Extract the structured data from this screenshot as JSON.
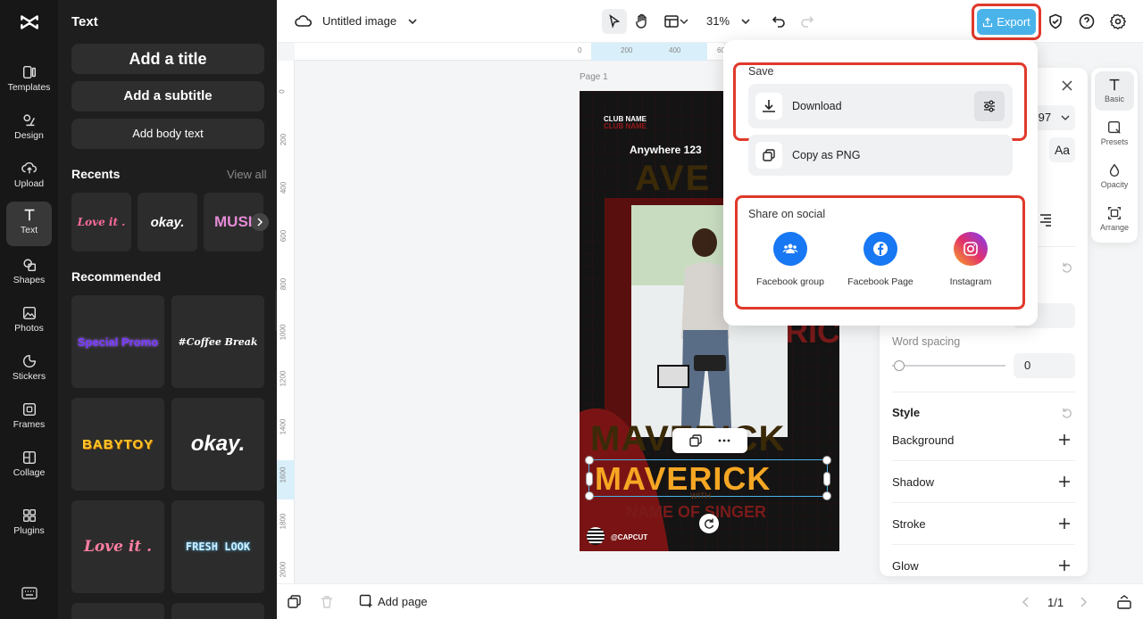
{
  "rail": {
    "items": [
      {
        "label": "Templates",
        "icon": "templates-icon"
      },
      {
        "label": "Design",
        "icon": "design-icon"
      },
      {
        "label": "Upload",
        "icon": "upload-icon"
      },
      {
        "label": "Text",
        "icon": "text-icon"
      },
      {
        "label": "Shapes",
        "icon": "shapes-icon"
      },
      {
        "label": "Photos",
        "icon": "photos-icon"
      },
      {
        "label": "Stickers",
        "icon": "stickers-icon"
      },
      {
        "label": "Frames",
        "icon": "frames-icon"
      },
      {
        "label": "Collage",
        "icon": "collage-icon"
      },
      {
        "label": "Plugins",
        "icon": "plugins-icon"
      }
    ]
  },
  "panel": {
    "heading": "Text",
    "add_title": "Add a title",
    "add_subtitle": "Add a subtitle",
    "add_body": "Add body text",
    "recents_label": "Recents",
    "view_all": "View all",
    "recents": [
      "Love it .",
      "okay.",
      "MUSIC"
    ],
    "recommended_label": "Recommended",
    "recommended": [
      "Special Promo",
      "#Coffee Break",
      "BABYTOY",
      "okay.",
      "Love it .",
      "FRESH LOOK"
    ]
  },
  "topbar": {
    "doc_title": "Untitled image",
    "zoom": "31%",
    "export_label": "Export"
  },
  "canvas": {
    "page_label": "Page 1",
    "ruler_top": [
      "0",
      "200",
      "400",
      "600"
    ],
    "ruler_left": [
      "0",
      "200",
      "400",
      "600",
      "800",
      "1000",
      "1200",
      "1400",
      "1600",
      "1800",
      "2000"
    ],
    "poster": {
      "club_name": "CLUB NAME",
      "club_name_ghost": "CLUB NAME",
      "address": "Anywhere 123",
      "ghost_word": "AVE",
      "headline": "MAVERICK",
      "ghost_headline": "MAVERICK",
      "with": "WITH",
      "singer": "NAME OF SINGER",
      "handle": "@CAPCUT",
      "side_ghost": "RICK"
    }
  },
  "popover": {
    "save_label": "Save",
    "download_label": "Download",
    "copy_label": "Copy as PNG",
    "share_label": "Share on social",
    "socials": [
      {
        "label": "Facebook group",
        "color": "#1877f2"
      },
      {
        "label": "Facebook Page",
        "color": "#1877f2"
      },
      {
        "label": "Instagram",
        "color": "#e1306c"
      }
    ]
  },
  "rpanel": {
    "font_size_fragment": ".97",
    "word_spacing_label": "Word spacing",
    "word_spacing_value": "0",
    "word_spacing_slider": 0.06,
    "style_label": "Style",
    "rows": [
      "Background",
      "Shadow",
      "Stroke",
      "Glow"
    ]
  },
  "rtabs": [
    "Basic",
    "Presets",
    "Opacity",
    "Arrange"
  ],
  "bottombar": {
    "add_page": "Add page",
    "page_count": "1/1"
  },
  "colors": {
    "export": "#4ab3ea",
    "highlight": "#e0392b",
    "accent_orange": "#f5a623"
  }
}
